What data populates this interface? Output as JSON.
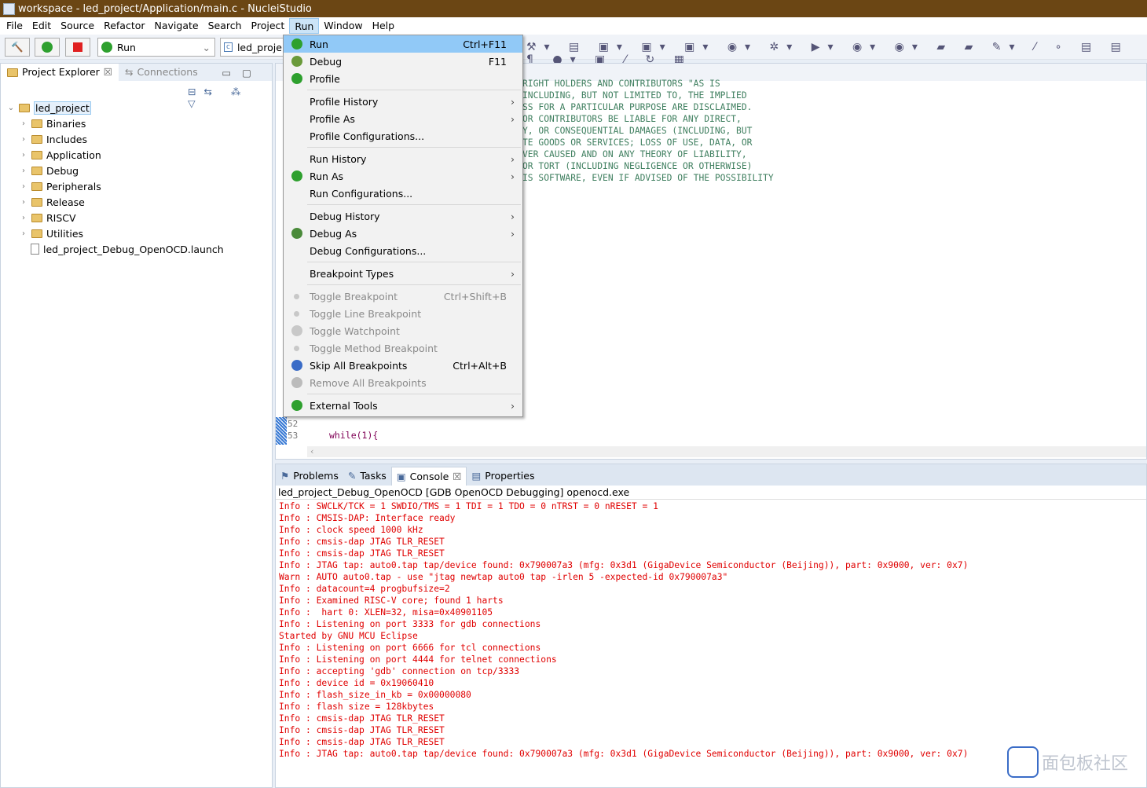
{
  "window": {
    "title": "workspace - led_project/Application/main.c - NucleiStudio"
  },
  "menubar": [
    "File",
    "Edit",
    "Source",
    "Refactor",
    "Navigate",
    "Search",
    "Project",
    "Run",
    "Window",
    "Help"
  ],
  "toolbar": {
    "launch_mode": "Run",
    "launch_config": "led_proje"
  },
  "left_panel": {
    "tabs": [
      "Project Explorer",
      "Connections"
    ],
    "tree": {
      "root": "led_project",
      "children": [
        "Binaries",
        "Includes",
        "Application",
        "Debug",
        "Peripherals",
        "Release",
        "RISCV",
        "Utilities"
      ],
      "file": "led_project_Debug_OpenOCD.launch"
    }
  },
  "editor": {
    "comment_lines": [
      "RIGHT HOLDERS AND CONTRIBUTORS \"AS IS",
      "INCLUDING, BUT NOT LIMITED TO, THE IMPLIED",
      "SS FOR A PARTICULAR PURPOSE ARE DISCLAIMED.",
      "OR CONTRIBUTORS BE LIABLE FOR ANY DIRECT,",
      "Y, OR CONSEQUENTIAL DAMAGES (INCLUDING, BUT",
      "TE GOODS OR SERVICES; LOSS OF USE, DATA, OR",
      "VER CAUSED AND ON ANY THEORY OF LIABILITY,",
      "OR TORT (INCLUDING NEGLIGENCE OR OTHERWISE)",
      "IS SOFTWARE, EVEN IF ADVISED OF THE POSSIBILITY"
    ],
    "line_52": "52",
    "line_53": "53",
    "code_53": "while(1){"
  },
  "run_menu": [
    {
      "label": "Run",
      "accel": "Ctrl+F11",
      "icon": "run-icon",
      "highlight": true
    },
    {
      "label": "Debug",
      "accel": "F11",
      "icon": "debug-icon"
    },
    {
      "label": "Profile",
      "icon": "profile-icon"
    },
    {
      "sep": true
    },
    {
      "label": "Profile History",
      "submenu": true
    },
    {
      "label": "Profile As",
      "submenu": true
    },
    {
      "label": "Profile Configurations..."
    },
    {
      "sep": true
    },
    {
      "label": "Run History",
      "submenu": true
    },
    {
      "label": "Run As",
      "submenu": true,
      "icon": "run-as-icon"
    },
    {
      "label": "Run Configurations..."
    },
    {
      "sep": true
    },
    {
      "label": "Debug History",
      "submenu": true
    },
    {
      "label": "Debug As",
      "submenu": true,
      "icon": "bug-icon"
    },
    {
      "label": "Debug Configurations..."
    },
    {
      "sep": true
    },
    {
      "label": "Breakpoint Types",
      "submenu": true
    },
    {
      "sep": true
    },
    {
      "label": "Toggle Breakpoint",
      "accel": "Ctrl+Shift+B",
      "disabled": true,
      "icon": "breakpoint-icon"
    },
    {
      "label": "Toggle Line Breakpoint",
      "disabled": true,
      "icon": "breakpoint-icon"
    },
    {
      "label": "Toggle Watchpoint",
      "disabled": true,
      "icon": "watchpoint-icon"
    },
    {
      "label": "Toggle Method Breakpoint",
      "disabled": true,
      "icon": "breakpoint-icon"
    },
    {
      "label": "Skip All Breakpoints",
      "accel": "Ctrl+Alt+B",
      "icon": "skip-breakpoints-icon"
    },
    {
      "label": "Remove All Breakpoints",
      "disabled": true,
      "icon": "remove-breakpoints-icon"
    },
    {
      "sep": true
    },
    {
      "label": "External Tools",
      "submenu": true,
      "icon": "external-tools-icon"
    }
  ],
  "console": {
    "tabs": [
      "Problems",
      "Tasks",
      "Console",
      "Properties"
    ],
    "header": "led_project_Debug_OpenOCD [GDB OpenOCD Debugging] openocd.exe",
    "lines": [
      "Info : SWCLK/TCK = 1 SWDIO/TMS = 1 TDI = 1 TDO = 0 nTRST = 0 nRESET = 1",
      "Info : CMSIS-DAP: Interface ready",
      "Info : clock speed 1000 kHz",
      "Info : cmsis-dap JTAG TLR_RESET",
      "Info : cmsis-dap JTAG TLR_RESET",
      "Info : JTAG tap: auto0.tap tap/device found: 0x790007a3 (mfg: 0x3d1 (GigaDevice Semiconductor (Beijing)), part: 0x9000, ver: 0x7)",
      "Warn : AUTO auto0.tap - use \"jtag newtap auto0 tap -irlen 5 -expected-id 0x790007a3\"",
      "Info : datacount=4 progbufsize=2",
      "Info : Examined RISC-V core; found 1 harts",
      "Info :  hart 0: XLEN=32, misa=0x40901105",
      "Info : Listening on port 3333 for gdb connections",
      "Started by GNU MCU Eclipse",
      "Info : Listening on port 6666 for tcl connections",
      "Info : Listening on port 4444 for telnet connections",
      "Info : accepting 'gdb' connection on tcp/3333",
      "Info : device id = 0x19060410",
      "Info : flash_size_in_kb = 0x00000080",
      "Info : flash size = 128kbytes",
      "Info : cmsis-dap JTAG TLR_RESET",
      "Info : cmsis-dap JTAG TLR_RESET",
      "Info : cmsis-dap JTAG TLR_RESET",
      "Info : JTAG tap: auto0.tap tap/device found: 0x790007a3 (mfg: 0x3d1 (GigaDevice Semiconductor (Beijing)), part: 0x9000, ver: 0x7)"
    ]
  },
  "watermark": "面包板社区"
}
